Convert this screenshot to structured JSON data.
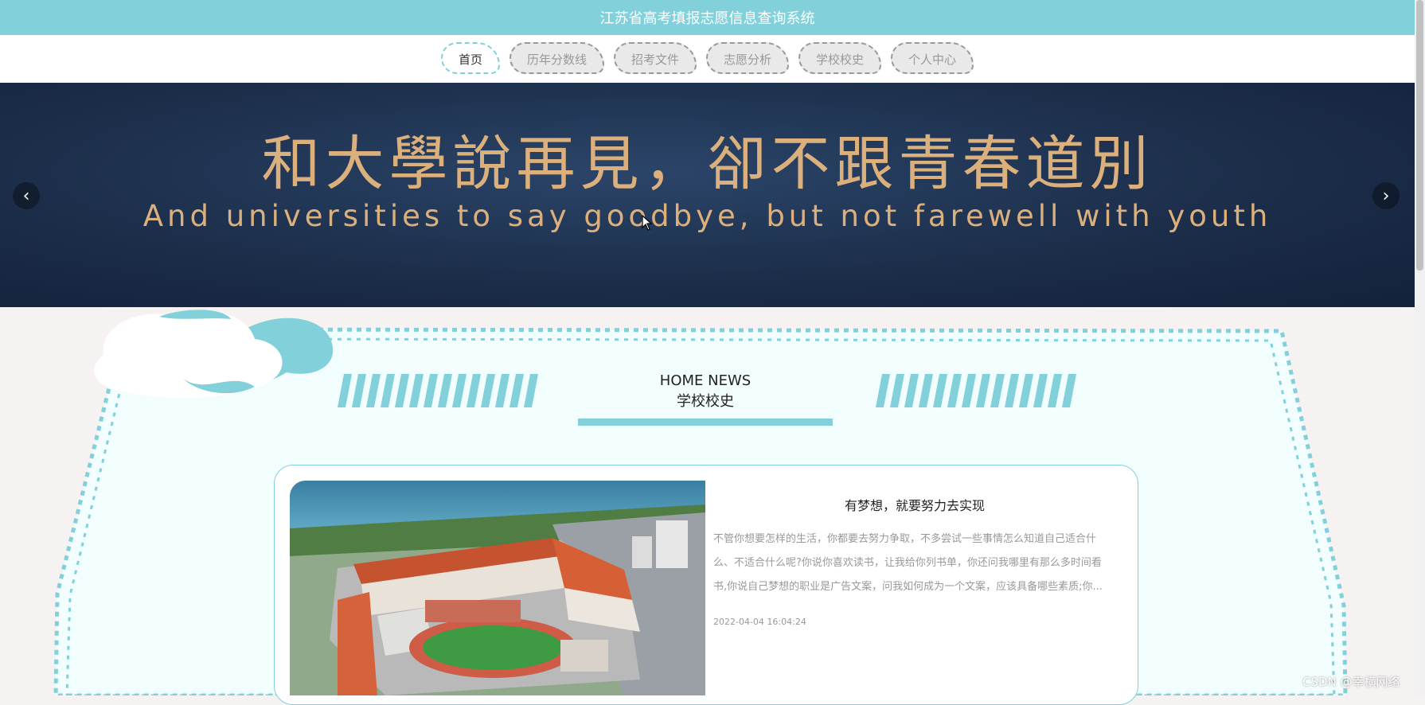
{
  "header": {
    "title": "江苏省高考填报志愿信息查询系统"
  },
  "nav": {
    "tabs": [
      {
        "label": "首页",
        "active": true
      },
      {
        "label": "历年分数线",
        "active": false
      },
      {
        "label": "招考文件",
        "active": false
      },
      {
        "label": "志愿分析",
        "active": false
      },
      {
        "label": "学校校史",
        "active": false
      },
      {
        "label": "个人中心",
        "active": false
      }
    ]
  },
  "banner": {
    "title_cn": "和大學說再見，卻不跟青春道別",
    "title_en": "And universities to say goodbye, but not farewell with youth"
  },
  "section": {
    "heading_en": "HOME NEWS",
    "heading_cn": "学校校史"
  },
  "news": {
    "title": "有梦想，就要努力去实现",
    "body": "不管你想要怎样的生活，你都要去努力争取，不多尝试一些事情怎么知道自己适合什么、不适合什么呢?你说你喜欢读书，让我给你列书单，你还问我哪里有那么多时间看书,你说自己梦想的职业是广告文案，问我如何成为一个文案，应该具备哪些素质;你...",
    "date": "2022-04-04 16:04:24"
  },
  "watermark": "CSDN @幸横网络",
  "colors": {
    "accent": "#82d0da",
    "banner_text": "#dcb07c",
    "banner_bg": "#1c2e4a"
  }
}
